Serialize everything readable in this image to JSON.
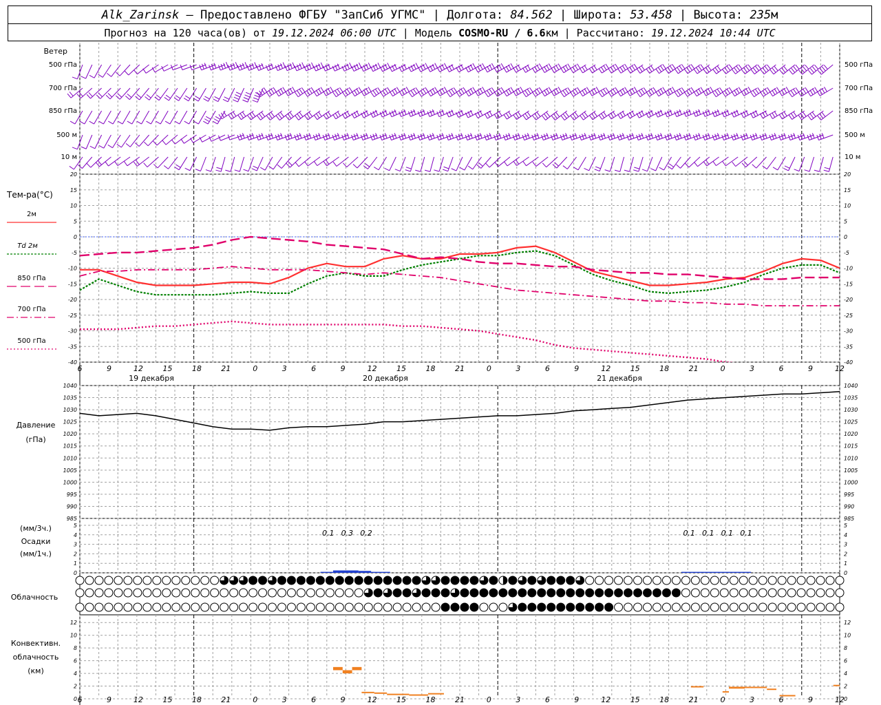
{
  "header": {
    "station": "Alk_Zarinsk",
    "provider": " – Предоставлено ФГБУ \"ЗапСиб УГМС\" | Долгота: ",
    "lon": "84.562",
    "lat_label": " | Широта: ",
    "lat": "53.458",
    "alt_label": " | Высота: ",
    "alt": "235",
    "alt_unit": "м",
    "forecast_label": "Прогноз на 120 часа(ов) от ",
    "forecast_time": "19.12.2024 06:00 UTC",
    "model_label": " | Модель ",
    "model": "COSMO-RU / 6.6",
    "model_unit": "км",
    "calc_label": " | Рассчитано: ",
    "calc_time": "19.12.2024 10:44 UTC"
  },
  "colors": {
    "wind": "#8000c0",
    "t2m": "#ff3030",
    "td2m": "#008000",
    "t850": "#e0006a",
    "t700": "#e0006a",
    "t500": "#e0006a",
    "pressure": "#000000",
    "precip": "#2040d0",
    "convective": "#f08020",
    "zero_line": "#4060ff",
    "grid": "#a0a0a0"
  },
  "x_axis": {
    "hour_labels": [
      "6",
      "9",
      "12",
      "15",
      "18",
      "21",
      "0",
      "3",
      "6",
      "9",
      "12",
      "15",
      "18",
      "21",
      "0",
      "3",
      "6",
      "9",
      "12",
      "15",
      "18",
      "21",
      "0",
      "3",
      "6",
      "9",
      "12"
    ],
    "day_labels": [
      "19 декабря",
      "20 декабря",
      "21 декабря"
    ]
  },
  "wind": {
    "title": "Ветер",
    "levels": [
      "500 гПа",
      "700 гПа",
      "850 гПа",
      "500 м",
      "10  м"
    ]
  },
  "chart_data": [
    {
      "type": "line",
      "title": "Тем-ра(°C)",
      "ylim": [
        -40,
        20
      ],
      "y_ticks": [
        20,
        15,
        10,
        5,
        0,
        -5,
        -10,
        -15,
        -20,
        -25,
        -30,
        -35,
        -40
      ],
      "x_hours_from_start": [
        0,
        3,
        6,
        9,
        12,
        15,
        18,
        21,
        24,
        27,
        30,
        33,
        36,
        39,
        42,
        45,
        48,
        51,
        54,
        57,
        60,
        63,
        66,
        69,
        72,
        75,
        78,
        81,
        84,
        87,
        90,
        93,
        96,
        99,
        102,
        105,
        108,
        111,
        114,
        117,
        120
      ],
      "series": [
        {
          "name": "2м",
          "values": [
            -10.5,
            -10.5,
            -12.5,
            -14.5,
            -15.5,
            -15.5,
            -15.5,
            -15,
            -14.5,
            -14.5,
            -15,
            -13,
            -10,
            -8.5,
            -9.5,
            -9.5,
            -7,
            -6,
            -7,
            -7,
            -5.5,
            -5.5,
            -5,
            -3.5,
            -3,
            -5,
            -8,
            -11,
            -12.5,
            -14,
            -15.5,
            -15.5,
            -15,
            -14.5,
            -13.5,
            -13,
            -11,
            -8.5,
            -7,
            -7.5,
            -10
          ]
        },
        {
          "name": "Td 2м",
          "values": [
            -17,
            -13.5,
            -15.5,
            -17.5,
            -18.5,
            -18.5,
            -18.5,
            -18.5,
            -18,
            -17.5,
            -18,
            -18,
            -15,
            -12.5,
            -11.5,
            -12.5,
            -12.5,
            -10.5,
            -9,
            -8,
            -7,
            -6,
            -6,
            -5,
            -4.5,
            -6,
            -9,
            -12,
            -14,
            -15.5,
            -17.5,
            -18,
            -17.5,
            -17,
            -16,
            -14.5,
            -12,
            -10,
            -9,
            -9,
            -11.5
          ]
        },
        {
          "name": "850 гПа",
          "values": [
            -6,
            -5.5,
            -5,
            -5,
            -4.5,
            -4,
            -3.5,
            -2.5,
            -1,
            0,
            -0.5,
            -1,
            -1.5,
            -2.5,
            -3,
            -3.5,
            -4,
            -5.5,
            -7,
            -6.5,
            -7,
            -8,
            -8.5,
            -8.5,
            -9,
            -9.5,
            -9.5,
            -10.5,
            -11,
            -11.5,
            -11.5,
            -12,
            -12,
            -12.5,
            -13,
            -13.5,
            -13.5,
            -13.5,
            -13,
            -13,
            -13
          ]
        },
        {
          "name": "700 гПа",
          "values": [
            -12.5,
            -11,
            -11,
            -10.5,
            -10.5,
            -10.5,
            -10.5,
            -10,
            -9.5,
            -10,
            -10.5,
            -10.5,
            -10.5,
            -11,
            -11.5,
            -12,
            -11.5,
            -12,
            -12.5,
            -13,
            -14,
            -15,
            -16,
            -17,
            -17.5,
            -18,
            -18.5,
            -19,
            -19.5,
            -20,
            -20.5,
            -20.5,
            -21,
            -21,
            -21.5,
            -21.5,
            -22,
            -22,
            -22,
            -22,
            -22
          ]
        },
        {
          "name": "500 гПа",
          "values": [
            -29.5,
            -29.5,
            -29.5,
            -29,
            -28.5,
            -28.5,
            -28,
            -27.5,
            -27,
            -27.5,
            -28,
            -28,
            -28,
            -28,
            -28,
            -28,
            -28,
            -28.5,
            -28.5,
            -29,
            -29.5,
            -30,
            -31,
            -32,
            -33,
            -34.5,
            -35.5,
            -36,
            -36.5,
            -37,
            -37.5,
            -38,
            -38.5,
            -39,
            -40,
            -40.5,
            -41,
            -41.5,
            -42,
            -42.5,
            -43
          ]
        }
      ]
    },
    {
      "type": "line",
      "title": "Давление",
      "units": "(гПа)",
      "ylim": [
        985,
        1040
      ],
      "y_ticks": [
        1040,
        1035,
        1030,
        1025,
        1020,
        1015,
        1010,
        1005,
        1000,
        995,
        990,
        985
      ],
      "x_hours_from_start": [
        0,
        3,
        6,
        9,
        12,
        15,
        18,
        21,
        24,
        27,
        30,
        33,
        36,
        39,
        42,
        45,
        48,
        51,
        54,
        57,
        60,
        63,
        66,
        69,
        72,
        75,
        78,
        81,
        84,
        87,
        90,
        93,
        96,
        99,
        102,
        105,
        108,
        111,
        114,
        117,
        120
      ],
      "series": [
        {
          "name": "Давление",
          "values": [
            1028.5,
            1027.5,
            1028,
            1028.5,
            1027.5,
            1026,
            1024.5,
            1023,
            1022,
            1022,
            1021.5,
            1022.5,
            1023,
            1023,
            1023.5,
            1024,
            1025,
            1025,
            1025.5,
            1026,
            1026.5,
            1027,
            1027.5,
            1027.5,
            1028,
            1028.5,
            1029.5,
            1030,
            1030.5,
            1031,
            1032,
            1033,
            1034,
            1034.5,
            1035,
            1035.5,
            1036,
            1036.5,
            1036.5,
            1037,
            1037.5
          ]
        }
      ]
    },
    {
      "type": "bar",
      "title": "Осадки",
      "units_top": "(мм/3ч.)",
      "units_bottom": "(мм/1ч.)",
      "ylim": [
        0,
        5
      ],
      "y_ticks": [
        5,
        4,
        3,
        2,
        1,
        0
      ],
      "labeled_values": [
        {
          "hour": 39,
          "value": "0.1"
        },
        {
          "hour": 42,
          "value": "0.3"
        },
        {
          "hour": 45,
          "value": "0.2"
        },
        {
          "hour": 96,
          "value": "0.1"
        },
        {
          "hour": 99,
          "value": "0.1"
        },
        {
          "hour": 102,
          "value": "0.1"
        },
        {
          "hour": 105,
          "value": "0.1"
        }
      ],
      "hourly_segments": [
        {
          "from": 38,
          "to": 40,
          "value": 0.1
        },
        {
          "from": 40,
          "to": 44,
          "value": 0.25
        },
        {
          "from": 44,
          "to": 46,
          "value": 0.2
        },
        {
          "from": 46,
          "to": 49,
          "value": 0.1
        },
        {
          "from": 95,
          "to": 106,
          "value": 0.1
        }
      ]
    },
    {
      "type": "table",
      "title": "Облачность",
      "note": "cover in oktas per 2-hour step, rows: upper, middle, lower",
      "rows": [
        [
          0,
          4,
          0,
          0,
          0,
          0,
          0,
          0,
          0,
          0,
          0,
          0,
          0,
          0,
          0,
          0,
          0,
          0,
          0,
          0,
          0,
          0,
          4,
          6,
          6,
          6,
          6,
          8,
          8,
          8,
          6,
          8,
          8,
          8,
          8,
          8,
          8,
          6,
          8,
          8,
          8,
          8,
          8,
          8,
          8,
          8,
          8,
          8,
          8,
          8,
          8,
          8,
          8,
          8,
          7,
          8,
          6,
          8,
          8,
          8,
          6,
          8,
          8,
          8,
          6,
          8,
          6,
          4,
          8,
          6,
          6,
          8,
          8,
          6,
          8,
          8,
          8,
          8,
          6,
          6,
          0,
          0,
          0,
          0,
          0,
          0,
          0,
          0,
          0,
          0,
          0,
          0,
          0,
          0,
          0,
          0,
          0,
          0,
          0,
          0,
          0,
          0,
          0,
          0,
          0,
          0,
          0,
          0,
          0,
          0,
          0,
          0,
          0,
          0,
          0,
          0,
          0,
          0,
          0,
          0,
          0
        ],
        [
          0,
          0,
          0,
          0,
          0,
          0,
          0,
          0,
          0,
          0,
          0,
          0,
          0,
          0,
          0,
          0,
          0,
          0,
          0,
          0,
          0,
          0,
          0,
          0,
          0,
          0,
          0,
          0,
          0,
          0,
          0,
          0,
          0,
          0,
          0,
          0,
          0,
          0,
          0,
          0,
          0,
          0,
          0,
          6,
          6,
          8,
          8,
          6,
          8,
          8,
          8,
          6,
          8,
          8,
          8,
          8,
          8,
          6,
          6,
          8,
          8,
          8,
          8,
          8,
          8,
          8,
          8,
          8,
          8,
          8,
          8,
          8,
          8,
          8,
          8,
          8,
          8,
          8,
          8,
          8,
          8,
          6,
          8,
          8,
          8,
          8,
          8,
          8,
          8,
          8,
          8,
          8,
          0,
          0,
          0,
          0,
          0,
          0,
          0,
          0,
          0,
          0,
          0,
          0,
          0,
          0,
          0,
          0,
          0,
          0,
          0,
          0,
          0,
          0,
          0,
          0,
          0
        ],
        [
          0,
          0,
          0,
          0,
          0,
          0,
          0,
          0,
          0,
          0,
          0,
          0,
          0,
          0,
          0,
          0,
          0,
          0,
          0,
          0,
          0,
          0,
          0,
          0,
          0,
          0,
          0,
          0,
          0,
          0,
          0,
          0,
          0,
          0,
          0,
          0,
          0,
          0,
          0,
          0,
          0,
          0,
          0,
          0,
          0,
          0,
          0,
          0,
          0,
          0,
          0,
          0,
          0,
          0,
          0,
          0,
          0,
          8,
          8,
          8,
          8,
          8,
          8,
          8,
          0,
          0,
          6,
          0,
          6,
          8,
          8,
          8,
          8,
          8,
          8,
          8,
          8,
          8,
          8,
          8,
          8,
          8,
          8,
          8,
          0,
          0,
          0,
          0,
          0,
          0,
          0,
          0,
          0,
          0,
          0,
          0,
          0,
          0,
          0,
          0,
          0,
          0,
          0,
          0,
          0,
          0,
          0,
          0,
          0,
          0,
          0,
          0,
          0,
          0,
          0,
          0,
          0,
          0,
          0,
          0,
          0
        ]
      ]
    },
    {
      "type": "bar",
      "title": "Конвективн. облачность",
      "units": "(км)",
      "ylim": [
        0,
        13
      ],
      "y_ticks": [
        12,
        10,
        8,
        6,
        4,
        2,
        0
      ],
      "segments": [
        {
          "from": 40,
          "to": 41.5,
          "base": 4.5,
          "top": 5
        },
        {
          "from": 41.5,
          "to": 43,
          "base": 4,
          "top": 4.5
        },
        {
          "from": 43,
          "to": 44.5,
          "base": 4.5,
          "top": 5
        },
        {
          "from": 44.5,
          "to": 46.5,
          "base": 1,
          "top": 1.1
        },
        {
          "from": 46.5,
          "to": 48.5,
          "base": 0.9,
          "top": 1
        },
        {
          "from": 48.5,
          "to": 52,
          "base": 0.7,
          "top": 0.8
        },
        {
          "from": 52,
          "to": 55,
          "base": 0.6,
          "top": 0.7
        },
        {
          "from": 55,
          "to": 57.5,
          "base": 0.8,
          "top": 0.9
        },
        {
          "from": 96.5,
          "to": 98.5,
          "base": 1.8,
          "top": 2
        },
        {
          "from": 101.5,
          "to": 102.5,
          "base": 1,
          "top": 1.2
        },
        {
          "from": 102.5,
          "to": 105,
          "base": 1.6,
          "top": 1.9
        },
        {
          "from": 105,
          "to": 108.5,
          "base": 1.7,
          "top": 1.9
        },
        {
          "from": 108.5,
          "to": 110,
          "base": 1.4,
          "top": 1.6
        },
        {
          "from": 110.5,
          "to": 113,
          "base": 0.5,
          "top": 0.6
        },
        {
          "from": 119,
          "to": 120,
          "base": 2,
          "top": 2.2
        }
      ]
    }
  ]
}
